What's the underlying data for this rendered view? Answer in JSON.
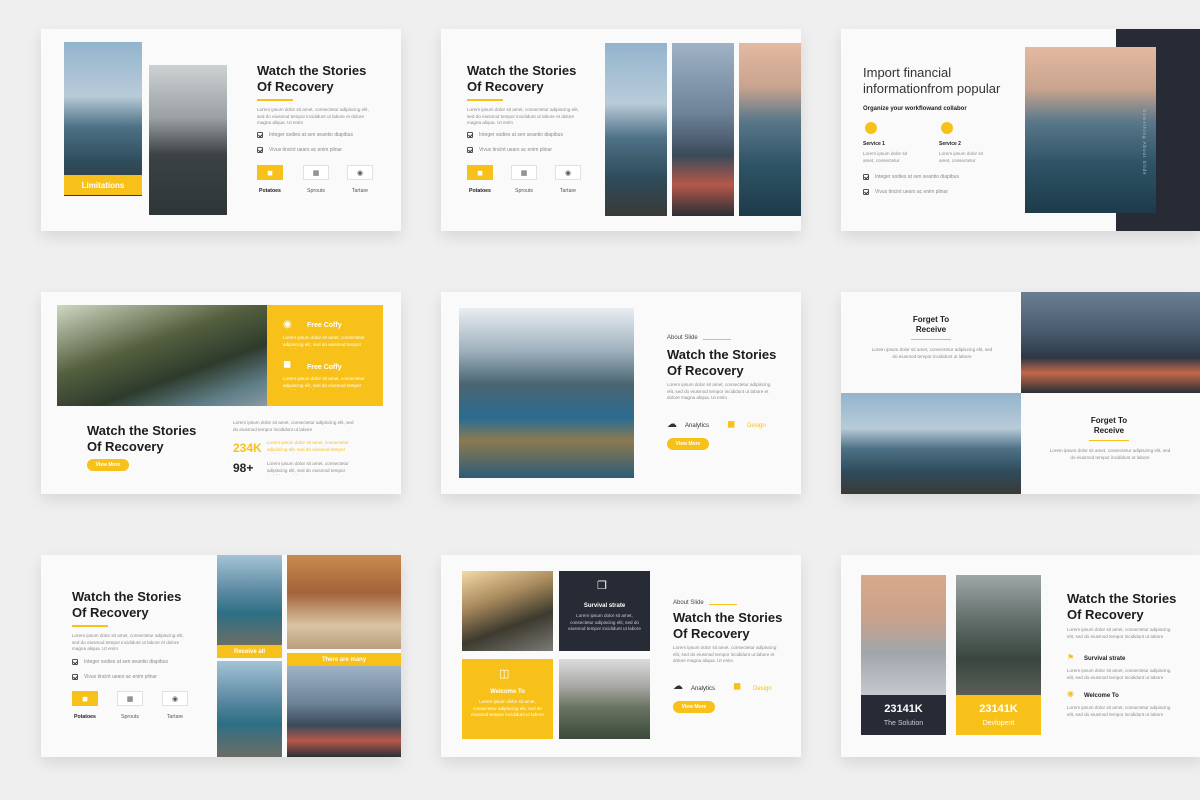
{
  "colors": {
    "accent": "#f7c11a",
    "dark": "#262b36",
    "background": "#efefef",
    "slide": "#fafafa"
  },
  "lorem2": "Lorem ipsum dolor sit amet, consectetur adipiscing elit, sed do eiusmod tempor incididunt ut labore et dolore magna aliqua. Ut enim",
  "lorem_short": "Lorem ipsum dolor sit amet, consectetur adipiscing elit, sed do eiusmod tempor incididunt ut labore",
  "slide1": {
    "title": "Watch the Stories\nOf Recovery",
    "check1": "Integer sodies at sen seantio diapibus",
    "check2": "Vivus tincint uears ac enim plinar",
    "caption": "Limitations",
    "tabs": [
      {
        "label": "Potatoes",
        "icon": "taxi-icon"
      },
      {
        "label": "Sprouts",
        "icon": "calendar-icon"
      },
      {
        "label": "Tartare",
        "icon": "camera-icon"
      }
    ]
  },
  "slide2": {
    "title": "Watch the Stories\nOf Recovery",
    "check1": "Integer sodies at sen seantio diapibus",
    "check2": "Vivus tincint uears ac enim plinar",
    "tabs": [
      {
        "label": "Potatoes"
      },
      {
        "label": "Sprouts"
      },
      {
        "label": "Tartare"
      }
    ]
  },
  "slide3": {
    "title": "Import financial\ninformationfrom popular",
    "subtitle": "Organize your workflowand collabor",
    "service1": "Service 1",
    "service2": "Service 2",
    "check1": "Integer sodies at sen seantio diapibus",
    "check2": "Vivus tincint uears ac enim plinar",
    "vertical": "Something About Slide"
  },
  "slide4": {
    "feature1": "Free Coffy",
    "feature2": "Free Coffy",
    "title": "Watch the Stories\nOf Recovery",
    "button": "View More",
    "stat1": "234K",
    "stat2": "98+"
  },
  "slide5": {
    "kicker": "About Slide",
    "title": "Watch the Stories\nOf Recovery",
    "item1": "Analytics",
    "item2": "Design",
    "button": "View More"
  },
  "slide6": {
    "title1": "Forget To\nReceive",
    "title2": "Forget To\nReceive"
  },
  "slide7": {
    "title": "Watch the Stories\nOf Recovery",
    "check1": "Integer sodies at sen seantio diapibus",
    "check2": "Vivus tincint uears ac enim plinar",
    "caption1": "Receive all",
    "caption2": "There are many",
    "tabs": [
      {
        "label": "Potatoes"
      },
      {
        "label": "Sprouts"
      },
      {
        "label": "Tartare"
      }
    ]
  },
  "slide8": {
    "box1": "Survival strate",
    "box2": "Welcome To",
    "kicker": "About Slide",
    "title": "Watch the Stories\nOf Recovery",
    "item1": "Analytics",
    "item2": "Design",
    "button": "View More"
  },
  "slide9": {
    "stat1_value": "23141K",
    "stat1_label": "The Solution",
    "stat2_value": "23141K",
    "stat2_label": "Devlopent",
    "title": "Watch the Stories\nOf Recovery",
    "item1": "Survival strate",
    "item2": "Welcome To"
  }
}
